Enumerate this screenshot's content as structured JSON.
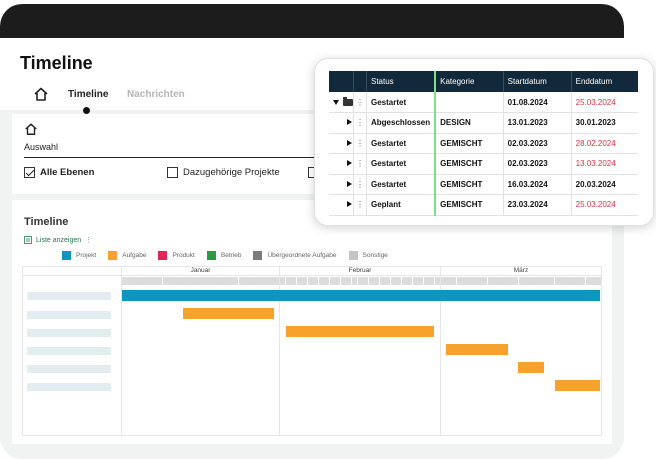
{
  "header": {
    "title": "Timeline",
    "tabs": [
      {
        "label": "Timeline",
        "active": true
      },
      {
        "label": "Nachrichten",
        "active": false
      }
    ]
  },
  "filter": {
    "label": "Auswahl",
    "checkboxes": [
      {
        "label": "Alle Ebenen",
        "checked": true
      },
      {
        "label": "Dazugehörige Projekte",
        "checked": false
      },
      {
        "label": "",
        "checked": false
      }
    ]
  },
  "timeline": {
    "title": "Timeline",
    "list_link": "Liste anzeigen",
    "legend": [
      {
        "label": "Projekt",
        "color": "#0e97be"
      },
      {
        "label": "Aufgabe",
        "color": "#f6a22d"
      },
      {
        "label": "Produkt",
        "color": "#e2245a"
      },
      {
        "label": "Betrieb",
        "color": "#2a9b43"
      },
      {
        "label": "Übergeordnete Aufgabe",
        "color": "#7b7b7b"
      },
      {
        "label": "Sonstige",
        "color": "#c4c4c4"
      }
    ],
    "months": [
      "Januar",
      "Februar",
      "März"
    ]
  },
  "chart_data": {
    "type": "gantt",
    "months": [
      "Januar",
      "Februar",
      "März"
    ],
    "bars": [
      {
        "category": "Projekt",
        "start": "2024-01-01",
        "end": "2024-03-31"
      },
      {
        "category": "Aufgabe",
        "start": "2024-01-13",
        "end": "2024-01-30"
      },
      {
        "category": "Aufgabe",
        "start": "2024-02-02",
        "end": "2024-02-28"
      },
      {
        "category": "Aufgabe",
        "start": "2024-03-02",
        "end": "2024-03-13"
      },
      {
        "category": "Aufgabe",
        "start": "2024-03-16",
        "end": "2024-03-20"
      },
      {
        "category": "Aufgabe",
        "start": "2024-03-23",
        "end": "2024-03-31"
      }
    ]
  },
  "table": {
    "headers": [
      "Status",
      "Kategorie",
      "Startdatum",
      "Enddatum"
    ],
    "rows": [
      {
        "status": "Gestartet",
        "kategorie": "",
        "start": "01.08.2024",
        "end": "25.03.2024",
        "end_red": true,
        "expanded": true
      },
      {
        "status": "Abgeschlossen",
        "kategorie": "DESIGN",
        "start": "13.01.2023",
        "end": "30.01.2023",
        "end_red": false,
        "expanded": false
      },
      {
        "status": "Gestartet",
        "kategorie": "GEMISCHT",
        "start": "02.03.2023",
        "end": "28.02.2024",
        "end_red": true,
        "expanded": false
      },
      {
        "status": "Gestartet",
        "kategorie": "GEMISCHT",
        "start": "02.03.2023",
        "end": "13.03.2024",
        "end_red": true,
        "expanded": false
      },
      {
        "status": "Gestartet",
        "kategorie": "GEMISCHT",
        "start": "16.03.2024",
        "end": "20.03.2024",
        "end_red": false,
        "expanded": false
      },
      {
        "status": "Geplant",
        "kategorie": "GEMISCHT",
        "start": "23.03.2024",
        "end": "25.03.2024",
        "end_red": true,
        "expanded": false
      }
    ]
  }
}
